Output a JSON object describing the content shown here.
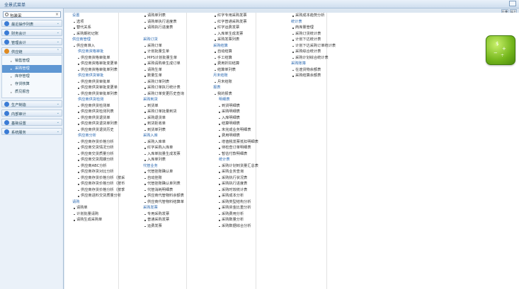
{
  "window": {
    "title": "全景式菜单"
  },
  "topright": [
    "折叠",
    "展开"
  ],
  "search": {
    "value": "包装采",
    "placeholder": ""
  },
  "nav": [
    {
      "label": "最近操作列表",
      "color": "#3a7bd5",
      "icon": "clock-icon"
    },
    {
      "label": "财务会计",
      "color": "#3a7bd5",
      "icon": "finance-icon"
    },
    {
      "label": "管理会计",
      "color": "#3a7bd5",
      "icon": "chart-icon"
    },
    {
      "label": "供应链",
      "color": "#e08a1f",
      "icon": "supply-chain-icon",
      "open": true
    }
  ],
  "supply_sub": [
    {
      "label": "销售管理"
    },
    {
      "label": "采购管理",
      "active": true
    },
    {
      "label": "库存管理"
    },
    {
      "label": "存货核算"
    },
    {
      "label": "质见报告"
    }
  ],
  "nav2": [
    {
      "label": "生产制造",
      "color": "#3a7bd5",
      "icon": "factory-icon"
    },
    {
      "label": "内部审计",
      "color": "#3a7bd5",
      "icon": "audit-icon"
    },
    {
      "label": "基础设置",
      "color": "#3a7bd5",
      "icon": "settings-icon"
    },
    {
      "label": "系统服务",
      "color": "#3a7bd5",
      "icon": "system-icon"
    }
  ],
  "col1": [
    {
      "t": "sec",
      "v": "设置"
    },
    {
      "t": "it",
      "v": "选项"
    },
    {
      "t": "it",
      "v": "替代关系"
    },
    {
      "t": "it",
      "v": "采购期初记账"
    },
    {
      "t": "sec",
      "v": "供应商管理"
    },
    {
      "t": "it",
      "v": "供应商准入"
    },
    {
      "t": "sec2",
      "v": "供应商资格审批"
    },
    {
      "t": "it2",
      "v": "供应商资格审批单"
    },
    {
      "t": "it2",
      "v": "供应商资格审批变更单"
    },
    {
      "t": "it2",
      "v": "供应商资格审批单列表"
    },
    {
      "t": "sec2",
      "v": "供应商供货审批"
    },
    {
      "t": "it2",
      "v": "供应商供货审批单"
    },
    {
      "t": "it2",
      "v": "供应商供货审批变更单"
    },
    {
      "t": "it2",
      "v": "供应商供货审批单列表"
    },
    {
      "t": "sec2",
      "v": "供应商供货检测"
    },
    {
      "t": "it2",
      "v": "供应商供货检测单"
    },
    {
      "t": "it2",
      "v": "供应商供货检测列表"
    },
    {
      "t": "it2",
      "v": "供应商供货退货单"
    },
    {
      "t": "it2",
      "v": "供应商供货退货单列表"
    },
    {
      "t": "it2",
      "v": "供应商供货退货历史"
    },
    {
      "t": "sec2",
      "v": "供应商分析"
    },
    {
      "t": "it2",
      "v": "供应商存货价格分析"
    },
    {
      "t": "it2",
      "v": "供应商交货情况分析"
    },
    {
      "t": "it2",
      "v": "供应商交货质量分析"
    },
    {
      "t": "it2",
      "v": "供应商交货周期分析"
    },
    {
      "t": "it2",
      "v": "供应商ABC分析"
    },
    {
      "t": "it2",
      "v": "供应商存货对比分析"
    },
    {
      "t": "it2",
      "v": "供应商存货价格分析（按采"
    },
    {
      "t": "it2",
      "v": "供应商存货价格分析（按币"
    },
    {
      "t": "it2",
      "v": "供应商存货价格分析（按季"
    },
    {
      "t": "it2",
      "v": "供应商进料交货质量分析"
    },
    {
      "t": "sec",
      "v": "请购"
    },
    {
      "t": "it",
      "v": "请购单"
    },
    {
      "t": "it",
      "v": "计划批量请购"
    },
    {
      "t": "it",
      "v": "请购生成采购单"
    }
  ],
  "col2": [
    {
      "t": "it",
      "v": "请购单列表"
    },
    {
      "t": "it",
      "v": "请购单执行进度表"
    },
    {
      "t": "it",
      "v": "请购执行进度表"
    },
    {
      "t": "gap"
    },
    {
      "t": "sec",
      "v": "采购订货"
    },
    {
      "t": "it",
      "v": "采购订单"
    },
    {
      "t": "it",
      "v": "计划批量生单"
    },
    {
      "t": "it",
      "v": "MPS计划批量生单"
    },
    {
      "t": "it",
      "v": "采购请购单生成订单"
    },
    {
      "t": "it",
      "v": "请购生单"
    },
    {
      "t": "it",
      "v": "数量生单"
    },
    {
      "t": "it",
      "v": "采购订单列表"
    },
    {
      "t": "it",
      "v": "采购订单执行统计表"
    },
    {
      "t": "it",
      "v": "采购订单变更历史查询"
    },
    {
      "t": "sec",
      "v": "采购到货"
    },
    {
      "t": "it",
      "v": "到货单"
    },
    {
      "t": "it",
      "v": "采购订单批量到货"
    },
    {
      "t": "it",
      "v": "采购退货单"
    },
    {
      "t": "it",
      "v": "到货拒收单"
    },
    {
      "t": "it",
      "v": "到货单列表"
    },
    {
      "t": "sec",
      "v": "采购入库"
    },
    {
      "t": "it",
      "v": "采购入库单"
    },
    {
      "t": "it",
      "v": "红字采购入库单"
    },
    {
      "t": "it",
      "v": "入库单批量生成发票"
    },
    {
      "t": "it",
      "v": "入库单列表"
    },
    {
      "t": "sec",
      "v": "代管业务"
    },
    {
      "t": "it",
      "v": "代管挂账确认单"
    },
    {
      "t": "it",
      "v": "自动挂账"
    },
    {
      "t": "it",
      "v": "代管挂账确认单列表"
    },
    {
      "t": "it",
      "v": "代管消耗明细表"
    },
    {
      "t": "it",
      "v": "供应商代管物料余额表"
    },
    {
      "t": "it",
      "v": "供应商代管物料结算单"
    },
    {
      "t": "sec",
      "v": "采购发票"
    },
    {
      "t": "it",
      "v": "专用采购发票"
    },
    {
      "t": "it",
      "v": "普通采购发票"
    },
    {
      "t": "it",
      "v": "运费发票"
    }
  ],
  "col3": [
    {
      "t": "it",
      "v": "红字专用采购发票"
    },
    {
      "t": "it",
      "v": "红字普通采购发票"
    },
    {
      "t": "it",
      "v": "红字运费发票"
    },
    {
      "t": "it",
      "v": "入库单生成发票"
    },
    {
      "t": "it",
      "v": "采购发票列表"
    },
    {
      "t": "sec",
      "v": "采购结算"
    },
    {
      "t": "it",
      "v": "自动结算"
    },
    {
      "t": "it",
      "v": "手工结算"
    },
    {
      "t": "it",
      "v": "费用折扣结算"
    },
    {
      "t": "it",
      "v": "结算单列表"
    },
    {
      "t": "sec",
      "v": "月末结账"
    },
    {
      "t": "it",
      "v": "月末结账"
    },
    {
      "t": "sec",
      "v": "报表"
    },
    {
      "t": "it",
      "v": "我的报表"
    },
    {
      "t": "sec2",
      "v": "明细表"
    },
    {
      "t": "it2",
      "v": "到货明细表"
    },
    {
      "t": "it2",
      "v": "采购明细表"
    },
    {
      "t": "it2",
      "v": "入库明细表"
    },
    {
      "t": "it2",
      "v": "结算明细表"
    },
    {
      "t": "it2",
      "v": "未完成业务明细表"
    },
    {
      "t": "it2",
      "v": "费用明细表"
    },
    {
      "t": "it2",
      "v": "增值税发票抵扣明细表"
    },
    {
      "t": "it2",
      "v": "待检查订单明细表"
    },
    {
      "t": "it2",
      "v": "暂估付款明细表"
    },
    {
      "t": "sec2",
      "v": "统计表"
    },
    {
      "t": "it2",
      "v": "采购计划到货量汇总表"
    },
    {
      "t": "it2",
      "v": "采购业务查询"
    },
    {
      "t": "it2",
      "v": "采购执行状况表"
    },
    {
      "t": "it2",
      "v": "采购执行进度表"
    },
    {
      "t": "it2",
      "v": "采购时效统计表"
    },
    {
      "t": "it2",
      "v": "采购成本分析"
    },
    {
      "t": "it2",
      "v": "采购类型结构分析"
    },
    {
      "t": "it2",
      "v": "采购资金比重分析"
    },
    {
      "t": "it2",
      "v": "采购费用分析"
    },
    {
      "t": "it2",
      "v": "采购数量分析"
    },
    {
      "t": "it2",
      "v": "采购数据综合分析"
    }
  ],
  "col4": [
    {
      "t": "it",
      "v": "采购成本趋势分析"
    },
    {
      "t": "sec",
      "v": "统计表"
    },
    {
      "t": "it",
      "v": "商库量管理"
    },
    {
      "t": "it",
      "v": "采购订货统计表"
    },
    {
      "t": "it",
      "v": "计划下达统计表"
    },
    {
      "t": "it",
      "v": "计划下达采购订单统计表"
    },
    {
      "t": "it",
      "v": "采购综合统计表"
    },
    {
      "t": "it",
      "v": "采购计划综合统计表"
    },
    {
      "t": "sec",
      "v": "采购账簿"
    },
    {
      "t": "it",
      "v": "在途货物余额表"
    },
    {
      "t": "it",
      "v": "采购结算余额表"
    }
  ]
}
